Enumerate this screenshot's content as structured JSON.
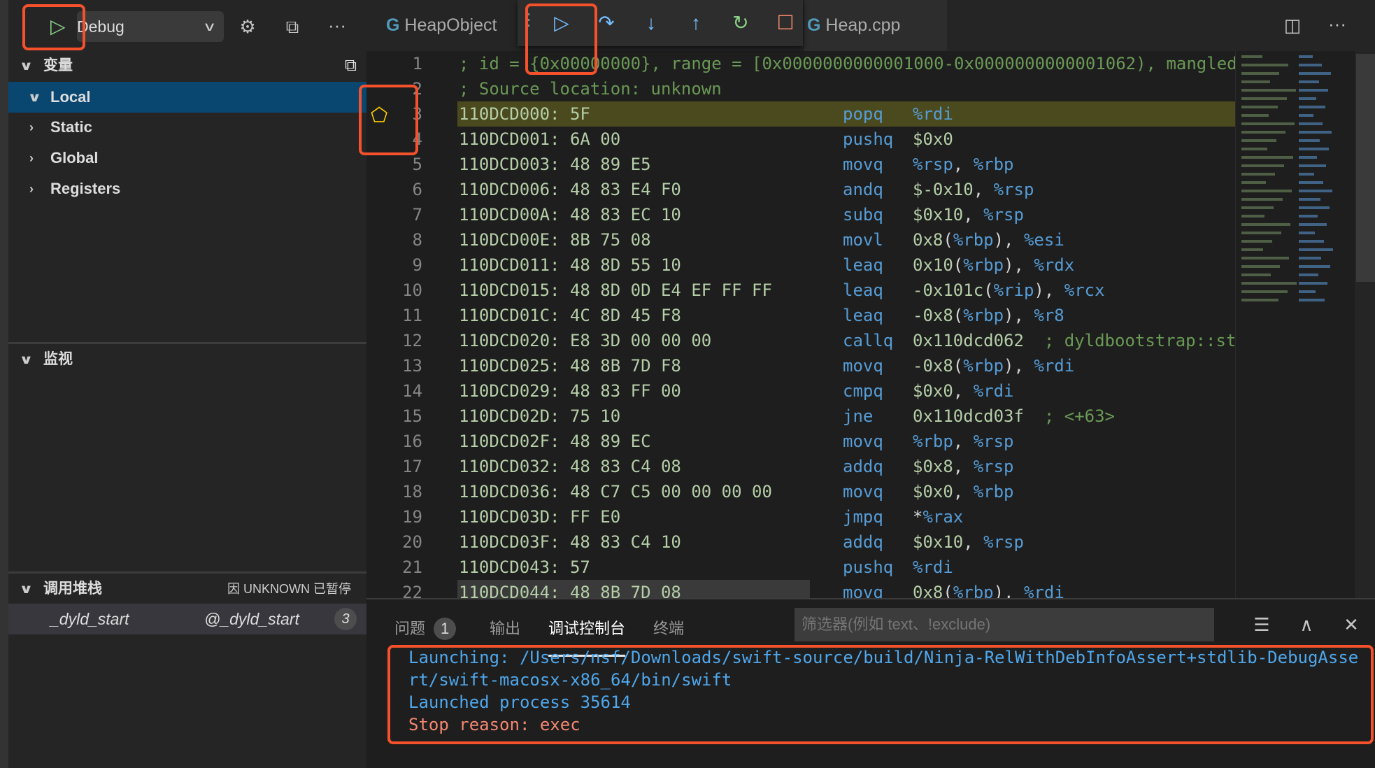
{
  "topbar": {
    "run_label": "Debug",
    "icons": [
      "play-icon",
      "chevron-down-icon",
      "gear-icon",
      "debug-console-icon",
      "more-icon"
    ]
  },
  "sidebar": {
    "variables_title": "变量",
    "variables": [
      {
        "label": "Local",
        "expanded": true,
        "selected": true
      },
      {
        "label": "Static",
        "expanded": false
      },
      {
        "label": "Global",
        "expanded": false
      },
      {
        "label": "Registers",
        "expanded": false
      }
    ],
    "watch_title": "监视",
    "callstack_title": "调用堆栈",
    "callstack_status": "因 UNKNOWN 已暂停",
    "callstack_frames": [
      {
        "name": "_dyld_start",
        "location": "@_dyld_start",
        "badge": "3"
      }
    ]
  },
  "tabs": [
    {
      "label": "HeapObject"
    },
    {
      "label": "Heap.cpp"
    }
  ],
  "debug_toolbar": [
    "continue",
    "step-over",
    "step-into",
    "step-out",
    "restart",
    "stop"
  ],
  "colors": {
    "accent": "#f4512c",
    "selection": "#094771",
    "current_line": "#4b4a1e",
    "mnemonic": "#569cd6",
    "number": "#b5cea8",
    "comment": "#6a9955"
  },
  "code": {
    "current_line": 3,
    "header": [
      "; id = {0x00000000}, range = [0x0000000000001000-0x0000000000001062), mangled",
      "; Source location: unknown"
    ],
    "lines": [
      {
        "n": "3",
        "addr": "110DCD000: 5F",
        "mn": "popq",
        "op": "%rdi"
      },
      {
        "n": "4",
        "addr": "110DCD001: 6A 00",
        "mn": "pushq",
        "op": "$0x0"
      },
      {
        "n": "5",
        "addr": "110DCD003: 48 89 E5",
        "mn": "movq",
        "op": "%rsp, %rbp"
      },
      {
        "n": "6",
        "addr": "110DCD006: 48 83 E4 F0",
        "mn": "andq",
        "op": "$-0x10, %rsp"
      },
      {
        "n": "7",
        "addr": "110DCD00A: 48 83 EC 10",
        "mn": "subq",
        "op": "$0x10, %rsp"
      },
      {
        "n": "8",
        "addr": "110DCD00E: 8B 75 08",
        "mn": "movl",
        "op": "0x8(%rbp), %esi"
      },
      {
        "n": "9",
        "addr": "110DCD011: 48 8D 55 10",
        "mn": "leaq",
        "op": "0x10(%rbp), %rdx"
      },
      {
        "n": "10",
        "addr": "110DCD015: 48 8D 0D E4 EF FF FF",
        "mn": "leaq",
        "op": "-0x101c(%rip), %rcx"
      },
      {
        "n": "11",
        "addr": "110DCD01C: 4C 8D 45 F8",
        "mn": "leaq",
        "op": "-0x8(%rbp), %r8"
      },
      {
        "n": "12",
        "addr": "110DCD020: E8 3D 00 00 00",
        "mn": "callq",
        "op": "0x110dcd062",
        "comment": "  ; dyldbootstrap::st"
      },
      {
        "n": "13",
        "addr": "110DCD025: 48 8B 7D F8",
        "mn": "movq",
        "op": "-0x8(%rbp), %rdi"
      },
      {
        "n": "14",
        "addr": "110DCD029: 48 83 FF 00",
        "mn": "cmpq",
        "op": "$0x0, %rdi"
      },
      {
        "n": "15",
        "addr": "110DCD02D: 75 10",
        "mn": "jne",
        "op": "0x110dcd03f",
        "comment": "  ; <+63>"
      },
      {
        "n": "16",
        "addr": "110DCD02F: 48 89 EC",
        "mn": "movq",
        "op": "%rbp, %rsp"
      },
      {
        "n": "17",
        "addr": "110DCD032: 48 83 C4 08",
        "mn": "addq",
        "op": "$0x8, %rsp"
      },
      {
        "n": "18",
        "addr": "110DCD036: 48 C7 C5 00 00 00 00",
        "mn": "movq",
        "op": "$0x0, %rbp"
      },
      {
        "n": "19",
        "addr": "110DCD03D: FF E0",
        "mn": "jmpq",
        "op": "*%rax"
      },
      {
        "n": "20",
        "addr": "110DCD03F: 48 83 C4 10",
        "mn": "addq",
        "op": "$0x10, %rsp"
      },
      {
        "n": "21",
        "addr": "110DCD043: 57",
        "mn": "pushq",
        "op": "%rdi"
      },
      {
        "n": "22",
        "addr": "110DCD044: 48 8B 7D 08",
        "mn": "movq",
        "op": "0x8(%rbp), %rdi"
      }
    ]
  },
  "panel": {
    "tabs": [
      {
        "label": "问题",
        "badge": "1"
      },
      {
        "label": "输出"
      },
      {
        "label": "调试控制台",
        "active": true
      },
      {
        "label": "终端"
      }
    ],
    "filter_placeholder": "筛选器(例如 text、!exclude)",
    "output": [
      {
        "text": "Launching: /Users/nsf/Downloads/swift-source/build/Ninja-RelWithDebInfoAssert+stdlib-DebugAsse",
        "kind": "info"
      },
      {
        "text": "rt/swift-macosx-x86_64/bin/swift",
        "kind": "info"
      },
      {
        "text": "Launched process 35614",
        "kind": "info"
      },
      {
        "text": "Stop reason: exec",
        "kind": "error"
      }
    ]
  }
}
